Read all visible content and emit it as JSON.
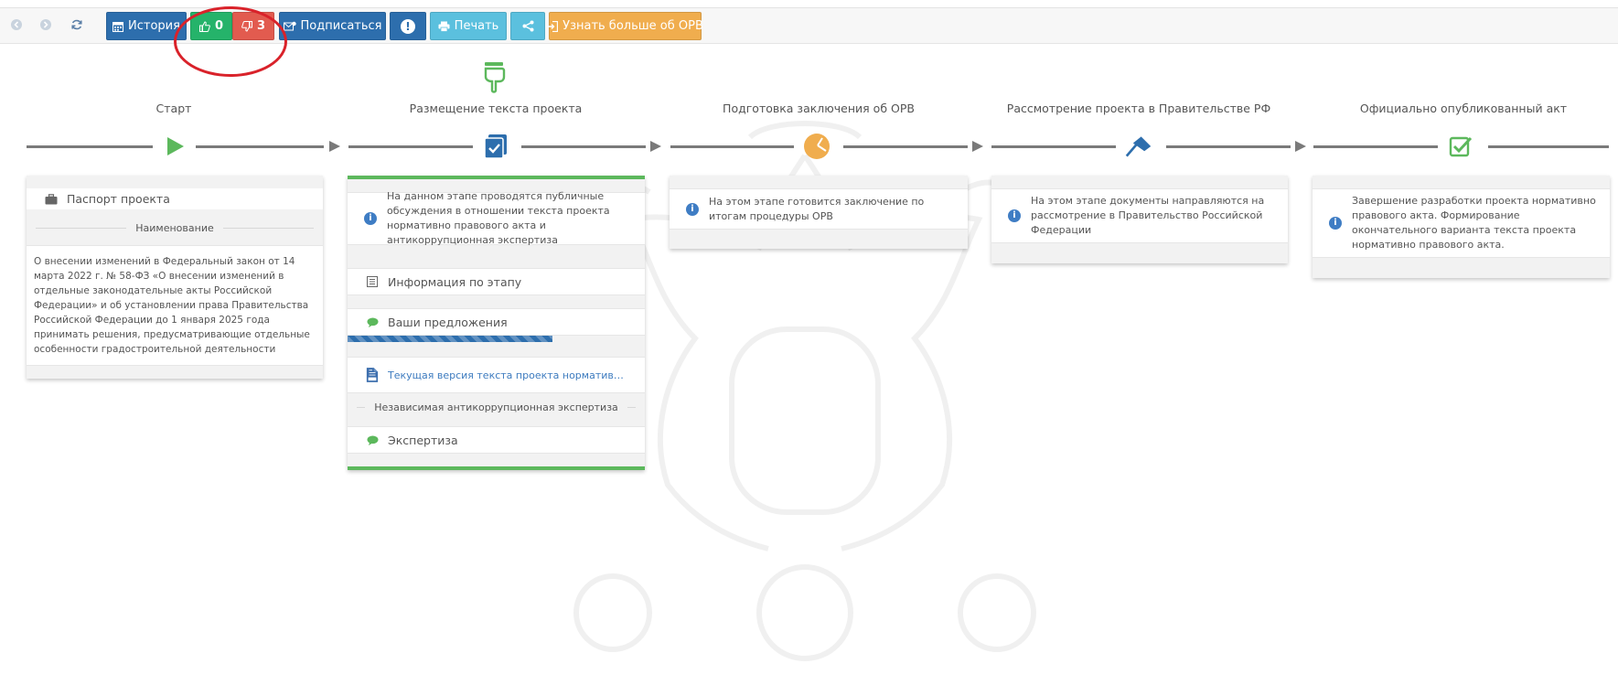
{
  "toolbar": {
    "history": "История",
    "likes": "0",
    "dislikes": "3",
    "subscribe": "Подписаться",
    "alert": "!",
    "print": "Печать",
    "learn_more": "Узнать больше об ОРВ"
  },
  "stages": [
    {
      "title": "Старт"
    },
    {
      "title": "Размещение текста проекта"
    },
    {
      "title": "Подготовка заключения об ОРВ"
    },
    {
      "title": "Рассмотрение проекта в Правительстве РФ"
    },
    {
      "title": "Официально опубликованный акт"
    }
  ],
  "passport": {
    "header": "Паспорт проекта",
    "name_label": "Наименование",
    "name_text": "О внесении изменений в Федеральный закон от 14 марта 2022 г. № 58-ФЗ «О внесении изменений в отдельные законодательные акты Российской Федерации» и об установлении права Правительства Российской Федерации до 1 января 2025 года принимать решения, предусматривающие отдельные особенности градостроительной деятельности"
  },
  "stage2": {
    "info": "На данном этапе проводятся публичные обсуждения в отношении текста проекта нормативно правового акта и антикоррупционная экспертиза",
    "stage_info": "Информация по этапу",
    "proposals": "Ваши предложения",
    "progress": 0.69,
    "doc_link": "Текущая версия текста проекта нормативного правового акта",
    "expertise_label": "Независимая антикоррупционная экспертиза",
    "expertise": "Экспертиза"
  },
  "stage3": {
    "info": "На этом этапе готовится заключение по итогам процедуры ОРВ"
  },
  "stage4": {
    "info": "На этом этапе документы направляются на рассмотрение в Правительство Российской Федерации"
  },
  "stage5": {
    "info": "Завершение разработки проекта нормативно правового акта. Формирование окончательного варианта текста проекта нормативно правового акта."
  },
  "colors": {
    "primary": "#2d6ead",
    "like": "#25b36a",
    "dislike": "#e25b4f",
    "accent_green": "#5cb85c",
    "orange": "#f0ad4e",
    "annotation": "#d9222a"
  },
  "icons": {
    "back": "arrow-left-icon",
    "forward": "arrow-right-icon",
    "refresh": "refresh-icon",
    "history": "calendar-icon",
    "like": "thumbs-up-icon",
    "dislike": "thumbs-down-icon",
    "subscribe": "envelope-icon",
    "print": "printer-icon",
    "share": "share-icon",
    "learn_more": "sign-in-icon"
  }
}
